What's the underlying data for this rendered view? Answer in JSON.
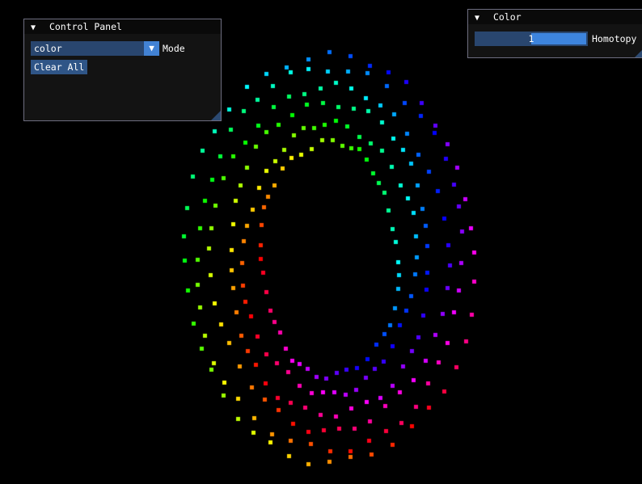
{
  "scene": {
    "description_colors": [
      "#ff0000",
      "#ff8800",
      "#ffff00",
      "#00ff44",
      "#00ffff",
      "#0033ff",
      "#8800ff",
      "#ff00aa"
    ]
  },
  "control_panel": {
    "title": "Control Panel",
    "collapse_icon": "triangle-down-icon",
    "mode_value": "color",
    "mode_label": "Mode",
    "dropdown_icon": "triangle-down-icon",
    "clear_label": "Clear All"
  },
  "color_panel": {
    "title": "Color",
    "collapse_icon": "triangle-down-icon",
    "homotopy_value": "1",
    "homotopy_label": "Homotopy"
  }
}
